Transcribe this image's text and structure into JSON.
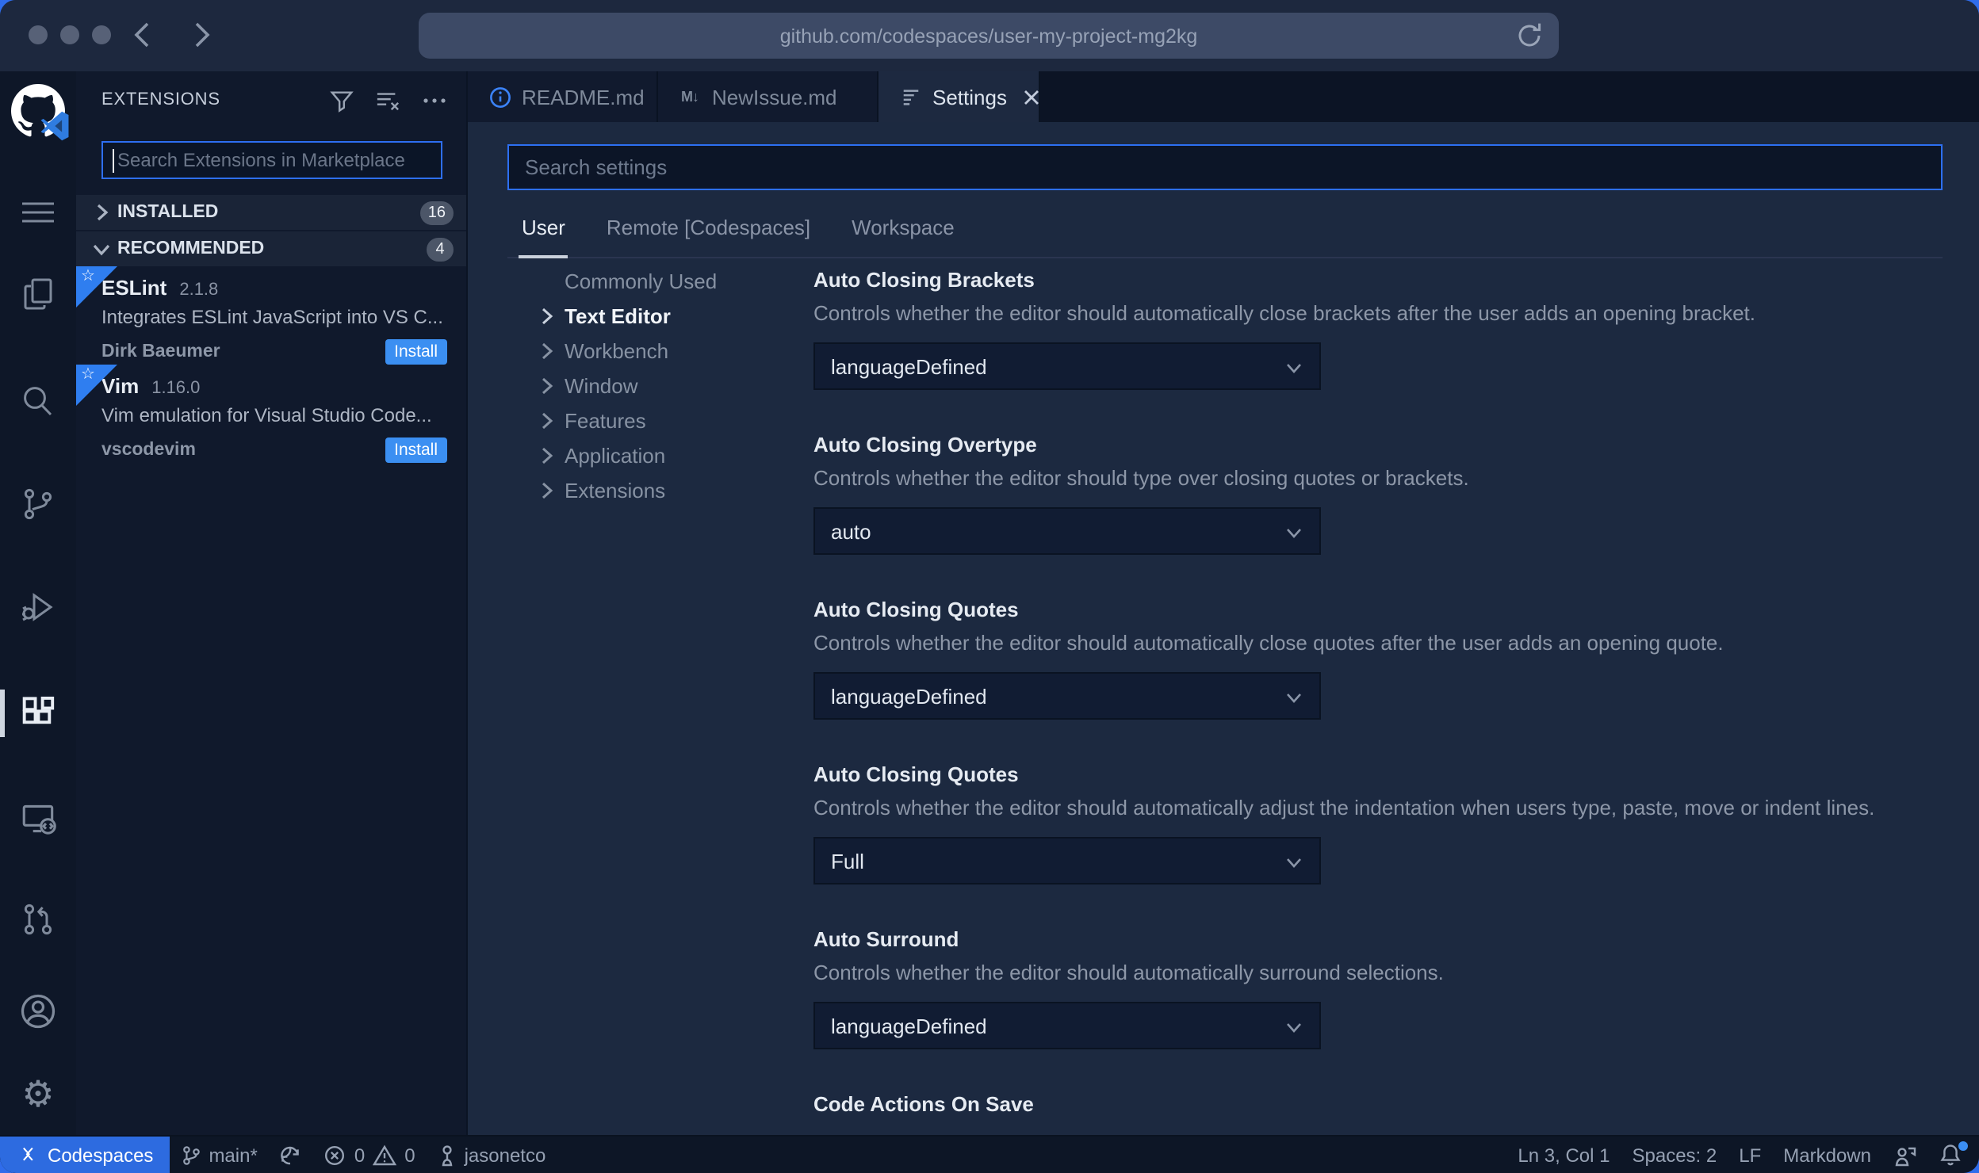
{
  "browser": {
    "url": "github.com/codespaces/user-my-project-mg2kg"
  },
  "sidebar": {
    "title": "EXTENSIONS",
    "search_placeholder": "Search Extensions in Marketplace",
    "sections": [
      {
        "label": "INSTALLED",
        "count": "16"
      },
      {
        "label": "RECOMMENDED",
        "count": "4"
      }
    ],
    "extensions": [
      {
        "name": "ESLint",
        "version": "2.1.8",
        "description": "Integrates ESLint JavaScript into VS C...",
        "publisher": "Dirk Baeumer",
        "action": "Install"
      },
      {
        "name": "Vim",
        "version": "1.16.0",
        "description": "Vim emulation for Visual Studio Code...",
        "publisher": "vscodevim",
        "action": "Install"
      }
    ]
  },
  "editor": {
    "tabs": [
      {
        "label": "README.md"
      },
      {
        "label": "NewIssue.md"
      },
      {
        "label": "Settings"
      }
    ]
  },
  "settings": {
    "search_placeholder": "Search settings",
    "scopes": [
      "User",
      "Remote [Codespaces]",
      "Workspace"
    ],
    "tree": [
      "Commonly Used",
      "Text Editor",
      "Workbench",
      "Window",
      "Features",
      "Application",
      "Extensions"
    ],
    "items": [
      {
        "title": "Auto Closing Brackets",
        "description": "Controls whether the editor should automatically close brackets after the user adds an opening bracket.",
        "value": "languageDefined"
      },
      {
        "title": "Auto Closing Overtype",
        "description": "Controls whether the editor should type over closing quotes or brackets.",
        "value": "auto"
      },
      {
        "title": "Auto Closing Quotes",
        "description": "Controls whether the editor should automatically close quotes after the user adds an opening quote.",
        "value": "languageDefined"
      },
      {
        "title": "Auto Closing Quotes",
        "description": "Controls whether the editor should automatically adjust the indentation when users type, paste, move or indent lines.",
        "value": "Full"
      },
      {
        "title": "Auto Surround",
        "description": "Controls whether the editor should automatically surround selections.",
        "value": "languageDefined"
      },
      {
        "title": "Code Actions On Save"
      }
    ]
  },
  "status_bar": {
    "codespaces_label": "Codespaces",
    "branch": "main*",
    "errors": "0",
    "warnings": "0",
    "user": "jasonetco",
    "cursor": "Ln 3, Col 1",
    "indent": "Spaces: 2",
    "eol": "LF",
    "language": "Markdown"
  },
  "colors": {
    "accent": "#2e6ff2",
    "install_button": "#3b8ff2",
    "codespaces_bg": "#2d6be0",
    "badge_bg": "#4c5668"
  }
}
